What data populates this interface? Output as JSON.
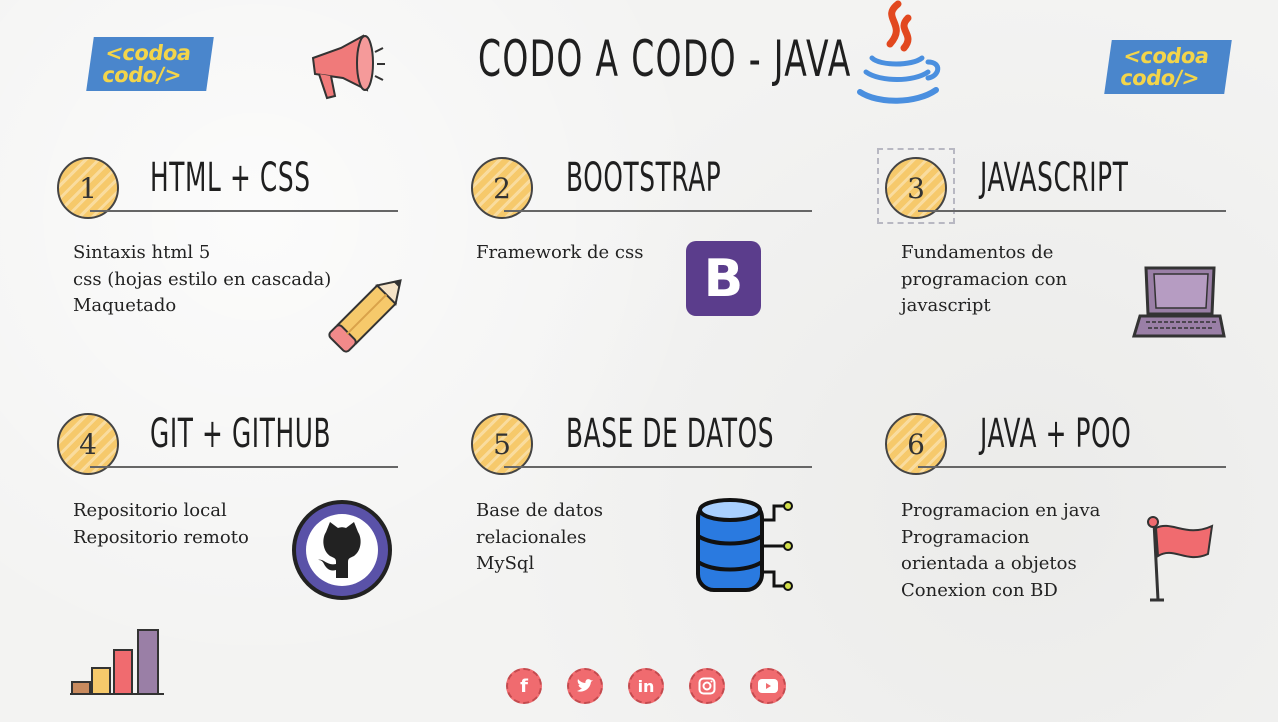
{
  "header": {
    "title": "CODO A CODO - JAVA",
    "logo_line1": "<codoa",
    "logo_line2": "codo/>"
  },
  "sections": [
    {
      "number": "1",
      "title": "HTML + CSS",
      "lines": [
        "Sintaxis html 5",
        "css (hojas estilo en cascada)",
        "Maquetado"
      ]
    },
    {
      "number": "2",
      "title": "BOOTSTRAP",
      "lines": [
        "Framework de css"
      ]
    },
    {
      "number": "3",
      "title": "JAVASCRIPT",
      "lines": [
        "Fundamentos de",
        "programacion con",
        "javascript"
      ]
    },
    {
      "number": "4",
      "title": "GIT + GITHUB",
      "lines": [
        "Repositorio local",
        "Repositorio remoto"
      ]
    },
    {
      "number": "5",
      "title": "BASE DE DATOS",
      "lines": [
        "Base de datos",
        "relacionales",
        "MySql"
      ]
    },
    {
      "number": "6",
      "title": "JAVA + POO",
      "lines": [
        "Programacion en java",
        "Programacion",
        "orientada a objetos",
        "Conexion con BD"
      ]
    }
  ],
  "icons": {
    "megaphone": "megaphone-icon",
    "java": "java-cup-icon",
    "pencil": "pencil-icon",
    "bootstrap": "bootstrap-icon",
    "bootstrap_letter": "B",
    "laptop": "laptop-icon",
    "github": "github-icon",
    "database": "database-icon",
    "flag": "flag-icon",
    "chart": "bar-chart-icon"
  },
  "social": [
    "facebook-icon",
    "twitter-icon",
    "linkedin-icon",
    "instagram-icon",
    "youtube-icon"
  ],
  "colors": {
    "logo_bg": "#4a86cc",
    "logo_text": "#f3d54a",
    "badge": "#f6c96b",
    "bootstrap": "#5b3d8c",
    "social": "#f06b6f"
  }
}
